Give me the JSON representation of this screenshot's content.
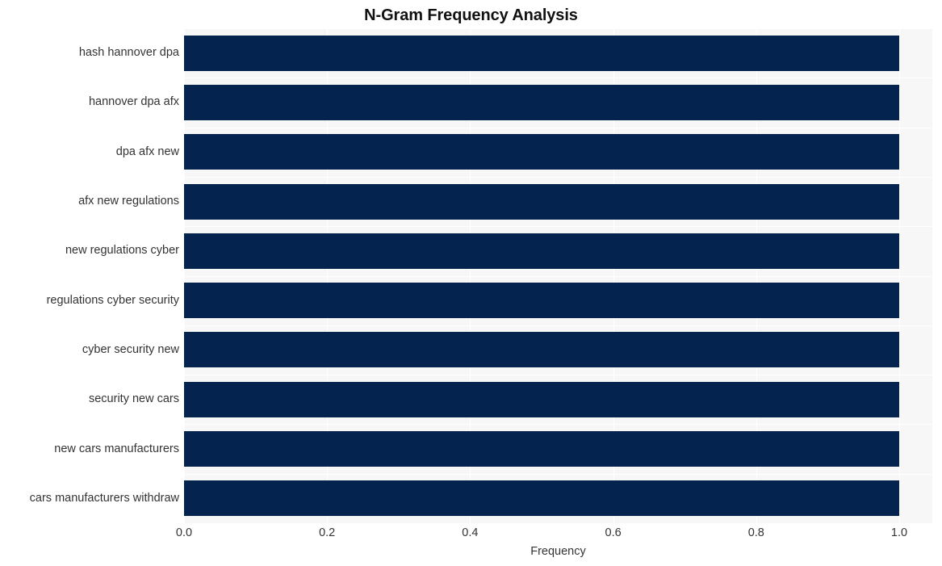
{
  "chart_data": {
    "type": "bar",
    "orientation": "horizontal",
    "title": "N-Gram Frequency Analysis",
    "xlabel": "Frequency",
    "ylabel": "",
    "xlim": [
      0.0,
      1.0
    ],
    "xticks": [
      "0.0",
      "0.2",
      "0.4",
      "0.6",
      "0.8",
      "1.0"
    ],
    "xtick_values": [
      0.0,
      0.2,
      0.4,
      0.6,
      0.8,
      1.0
    ],
    "grid": true,
    "legend": "none",
    "categories": [
      "hash hannover dpa",
      "hannover dpa afx",
      "dpa afx new",
      "afx new regulations",
      "new regulations cyber",
      "regulations cyber security",
      "cyber security new",
      "security new cars",
      "new cars manufacturers",
      "cars manufacturers withdraw"
    ],
    "values": [
      1.0,
      1.0,
      1.0,
      1.0,
      1.0,
      1.0,
      1.0,
      1.0,
      1.0,
      1.0
    ],
    "colors": {
      "bar": "#04234e",
      "plot_background": "#f7f7f7",
      "figure_background": "#ffffff",
      "gridline": "#ffffff",
      "text": "#333333",
      "title_text": "#111111"
    }
  }
}
